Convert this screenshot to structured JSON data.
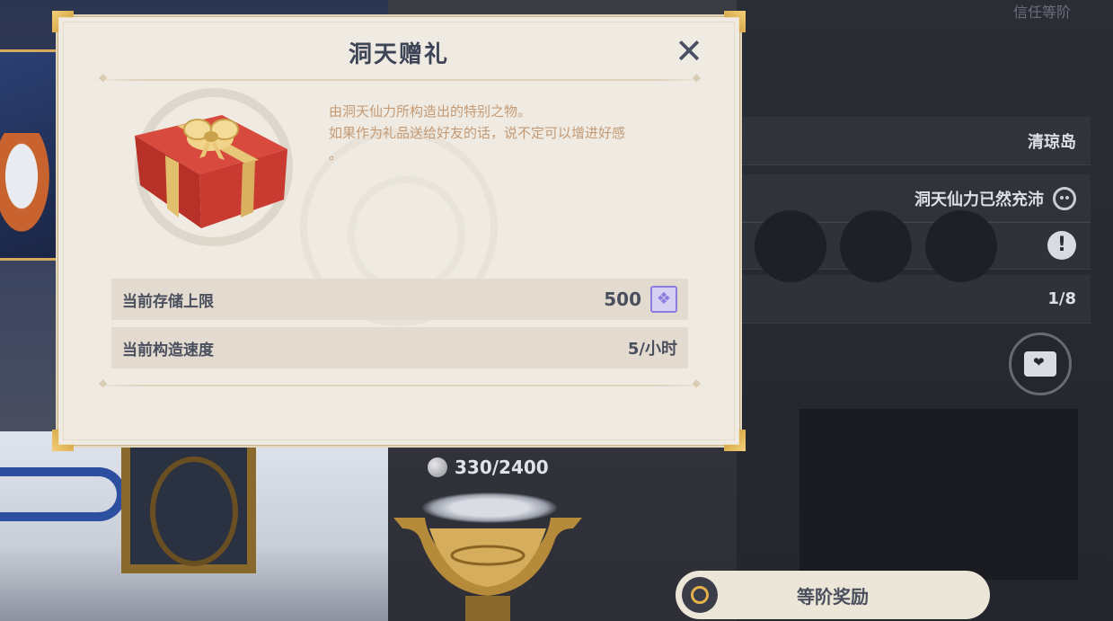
{
  "background": {
    "trust_label": "信任等阶",
    "panel": {
      "location": "清琼岛",
      "adeptal_status": "洞天仙力已然充沛",
      "count": "1/8"
    },
    "coins": "330/2400",
    "tier_button_label": "等阶奖励"
  },
  "modal": {
    "title": "洞天赠礼",
    "close_symbol": "✕",
    "description_line1": "由洞天仙力所构造出的特别之物。",
    "description_line2": "如果作为礼品送给好友的话，说不定可以增进好感",
    "description_line3": "。",
    "stats": [
      {
        "label": "当前存储上限",
        "value": "500"
      },
      {
        "label": "当前构造速度",
        "value": "5/小时"
      }
    ]
  },
  "icons": {
    "gift": "gift-box-icon",
    "realm_currency": "realm-currency-icon",
    "spirit": "teapot-spirit-icon",
    "warning": "exclamation-icon",
    "chest": "chest-heart-icon",
    "coin": "coin-icon"
  },
  "colors": {
    "modal_bg": "#efebe3",
    "title": "#3e4557",
    "description": "#c49a74",
    "stat_row_bg": "#e3dbcf",
    "gold_accent": "#e3b04b",
    "currency_purple": "#8d7be0"
  }
}
